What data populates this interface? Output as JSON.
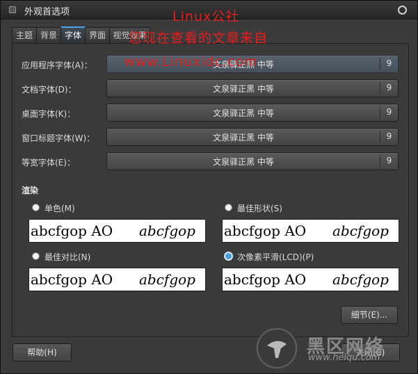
{
  "window": {
    "title": "外观首选项"
  },
  "tabs": [
    "主题",
    "背景",
    "字体",
    "界面",
    "视觉效果"
  ],
  "fonts": [
    {
      "label": "应用程序字体(A)：",
      "name": "文泉驿正黑 中等",
      "size": "9"
    },
    {
      "label": "文档字体(D)：",
      "name": "文泉驿正黑 中等",
      "size": "9"
    },
    {
      "label": "桌面字体(K)：",
      "name": "文泉驿正黑 中等",
      "size": "9"
    },
    {
      "label": "窗口标题字体(W)：",
      "name": "文泉驿正黑 中等",
      "size": "9"
    },
    {
      "label": "等宽字体(E)：",
      "name": "文泉驿正黑 中等",
      "size": "9"
    }
  ],
  "rendering": {
    "heading": "渲染",
    "options": [
      {
        "label": "单色(M)",
        "selected": false
      },
      {
        "label": "最佳形状(S)",
        "selected": false
      },
      {
        "label": "最佳对比(N)",
        "selected": false
      },
      {
        "label": "次像素平滑(LCD)(P)",
        "selected": true
      }
    ],
    "preview_regular": "abcfgop AO",
    "preview_italic": "abcfgop"
  },
  "buttons": {
    "details": "细节(E)...",
    "help": "帮助(H)",
    "close": "关闭(C)"
  },
  "watermark": {
    "line1": "Linux公社",
    "line2": "您现在查看的文章来自",
    "line3": "www.Linuxidc.com"
  },
  "logo": {
    "text": "黑区网络",
    "url": "www.heiqu.com"
  }
}
